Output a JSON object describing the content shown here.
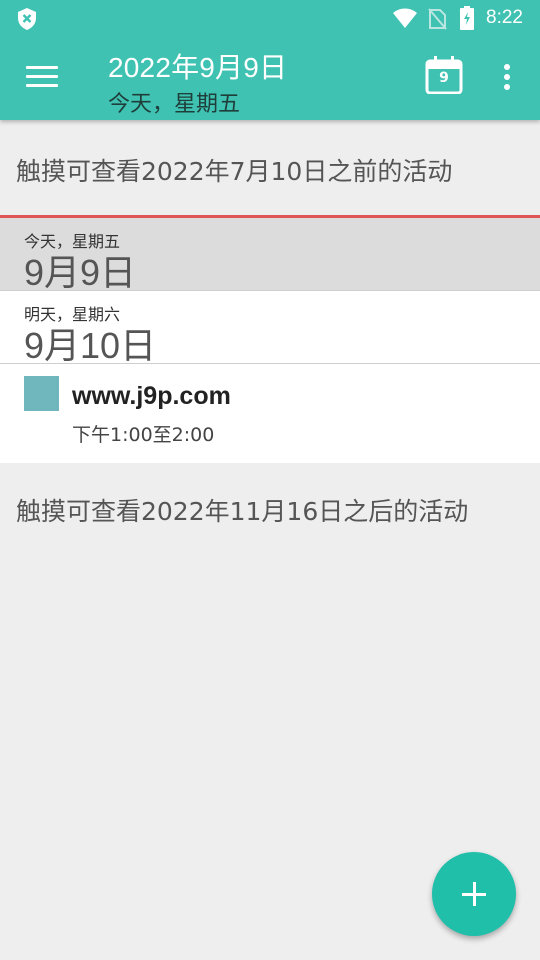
{
  "status_bar": {
    "time": "8:22",
    "icons": [
      "shield-icon",
      "wifi-icon",
      "no-sim-icon",
      "battery-charging-icon"
    ]
  },
  "appbar": {
    "title": "2022年9月9日",
    "subtitle": "今天，星期五",
    "calendar_day": "9",
    "icons": [
      "menu-icon",
      "calendar-icon",
      "more-vert-icon"
    ]
  },
  "list": {
    "load_before": "触摸可查看2022年7月10日之前的活动",
    "load_after": "触摸可查看2022年11月16日之后的活动",
    "days": [
      {
        "sub": "今天，星期五",
        "main": "9月9日"
      },
      {
        "sub": "明天，星期六",
        "main": "9月10日"
      }
    ],
    "events": [
      {
        "title": "www.j9p.com",
        "time": "下午1:00至2:00",
        "color": "#6fb7bd"
      }
    ]
  },
  "colors": {
    "appbar": "#3fc2b2",
    "fab": "#1fbfaa",
    "today_line": "#e05656"
  },
  "fab": {
    "icon": "add-icon"
  }
}
